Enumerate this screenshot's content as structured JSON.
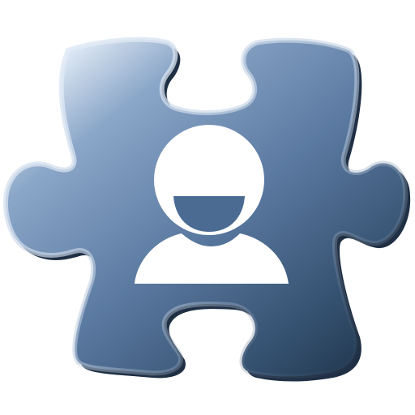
{
  "icon": {
    "name": "puzzle-piece-user-icon",
    "puzzle_piece": {
      "colors": {
        "highlight": "#dbe6f3",
        "light": "#8aa6c8",
        "mid": "#5b7aa1",
        "dark": "#34506f",
        "darkest": "#243a52",
        "edge_shadow": "#1f2f44",
        "rim_highlight": "#e9f1fb"
      }
    },
    "user_glyph": {
      "name": "user-icon",
      "color": "#ffffff",
      "smile_color": "#4b6b93"
    }
  }
}
